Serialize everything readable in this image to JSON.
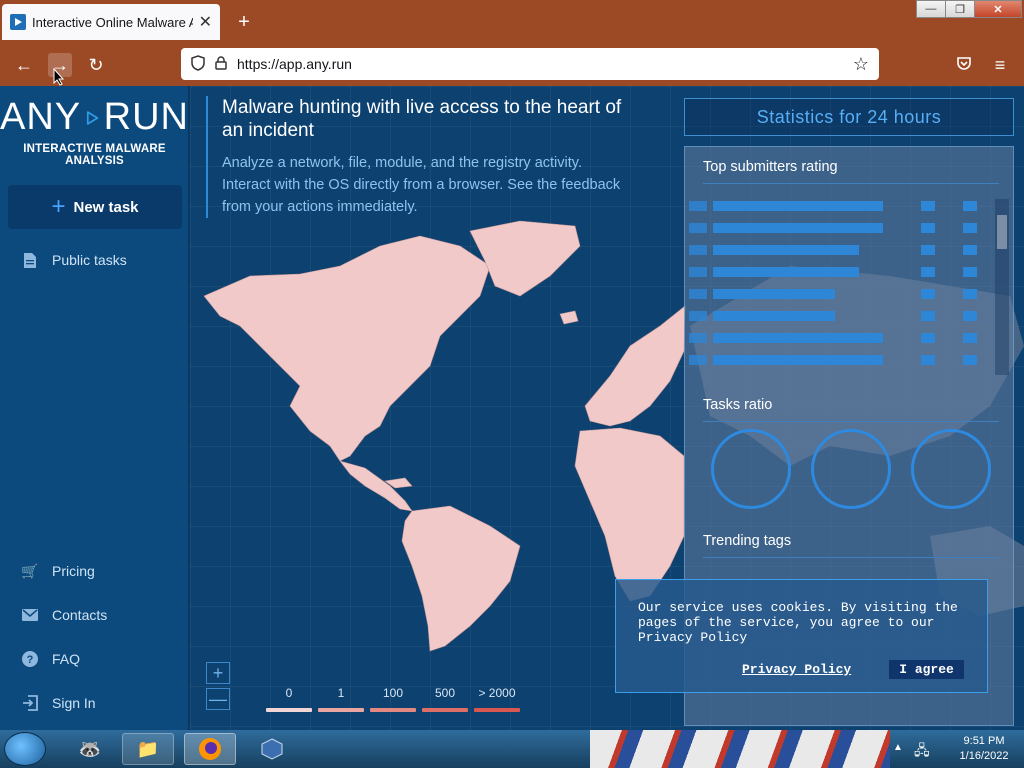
{
  "browser": {
    "tab_title": "Interactive Online Malware Ana",
    "tab_close": "✕",
    "new_tab": "+",
    "url": "https://app.any.run",
    "window_minimize": "—",
    "window_restore": "❐",
    "window_close": "✕"
  },
  "sidebar": {
    "logo_left": "ANY",
    "logo_right": "RUN",
    "tagline": "INTERACTIVE MALWARE ANALYSIS",
    "new_task": "New task",
    "public_tasks": "Public tasks",
    "pricing": "Pricing",
    "contacts": "Contacts",
    "faq": "FAQ",
    "sign_in": "Sign In"
  },
  "main": {
    "headline": "Malware hunting with live access to the heart of an incident",
    "description": "Analyze a network, file, module, and the registry activity. Interact with the OS directly from a browser. See the feedback from your actions immediately.",
    "zoom_in": "+",
    "zoom_out": "—",
    "legend": [
      {
        "label": "0",
        "color": "#f2d6d6"
      },
      {
        "label": "1",
        "color": "#e9a6a0"
      },
      {
        "label": "100",
        "color": "#e28a82"
      },
      {
        "label": "500",
        "color": "#dd6f66"
      },
      {
        "label": "> 2000",
        "color": "#d8574e"
      }
    ]
  },
  "stats": {
    "header": "Statistics for 24 hours",
    "top_submitters": "Top submitters rating",
    "tasks_ratio": "Tasks ratio",
    "trending_tags": "Trending tags"
  },
  "cookie": {
    "text": "Our service uses cookies. By visiting the pages of the service, you agree to our Privacy Policy",
    "privacy_link": "Privacy Policy",
    "agree": "I agree"
  },
  "taskbar": {
    "time": "9:51 PM",
    "date": "1/16/2022"
  },
  "colors": {
    "accent": "#2f8ad6",
    "sidebar": "#0c4a7e",
    "map_land": "#f2c9c9"
  }
}
